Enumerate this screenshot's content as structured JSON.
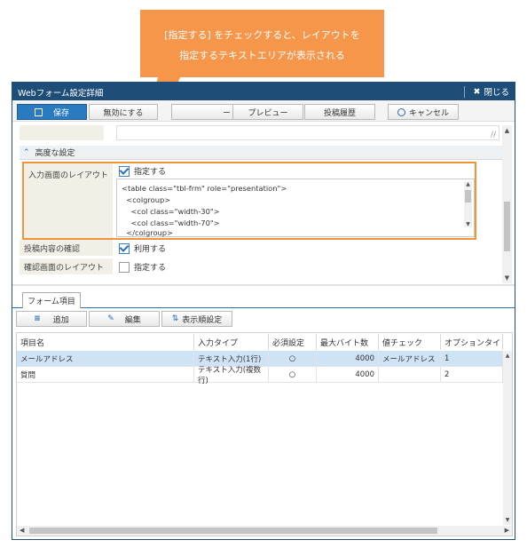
{
  "callout": {
    "line1": "[指定する] をチェックすると、レイアウトを",
    "line2": "指定するテキストエリアが表示される"
  },
  "window": {
    "title": "Webフォーム設定詳細",
    "close_label": "閉じる"
  },
  "toolbar": {
    "save": "保存",
    "disable": "無効にする",
    "cancel_partial": "ー",
    "preview": "プレビュー",
    "history": "投稿履歴",
    "cancel": "キャンセル"
  },
  "advanced": {
    "header": "高度な設定",
    "layout_label": "入力画面のレイアウト",
    "layout_checkbox": "指定する",
    "layout_checked": true,
    "code_lines": [
      "<table class=\"tbl-frm\" role=\"presentation\">",
      "  <colgroup>",
      "    <col class=\"width-30\">",
      "    <col class=\"width-70\">",
      "  </colgroup>"
    ],
    "confirm_label": "投稿内容の確認",
    "confirm_checkbox": "利用する",
    "confirm_checked": true,
    "confirm_layout_label": "確認画面のレイアウト",
    "confirm_layout_checkbox": "指定する",
    "confirm_layout_checked": false
  },
  "form_items": {
    "tab": "フォーム項目",
    "add": "追加",
    "edit": "編集",
    "order": "表示順設定",
    "columns": [
      "項目名",
      "入力タイプ",
      "必須設定",
      "最大バイト数",
      "値チェック",
      "オプションタイ"
    ],
    "rows": [
      {
        "name": "メールアドレス",
        "type": "テキスト入力(1行)",
        "required": "○",
        "max": "4000",
        "check": "メールアドレス",
        "option": "1",
        "selected": true
      },
      {
        "name": "質問",
        "type": "テキスト入力(複数行)",
        "required": "○",
        "max": "4000",
        "check": "",
        "option": "2",
        "selected": false
      }
    ]
  },
  "colors": {
    "titlebar": "#1e4d78",
    "primary": "#2a7ac0",
    "highlight": "#f0933b",
    "callout": "#f6964a",
    "selected_row": "#cfe3f7"
  }
}
